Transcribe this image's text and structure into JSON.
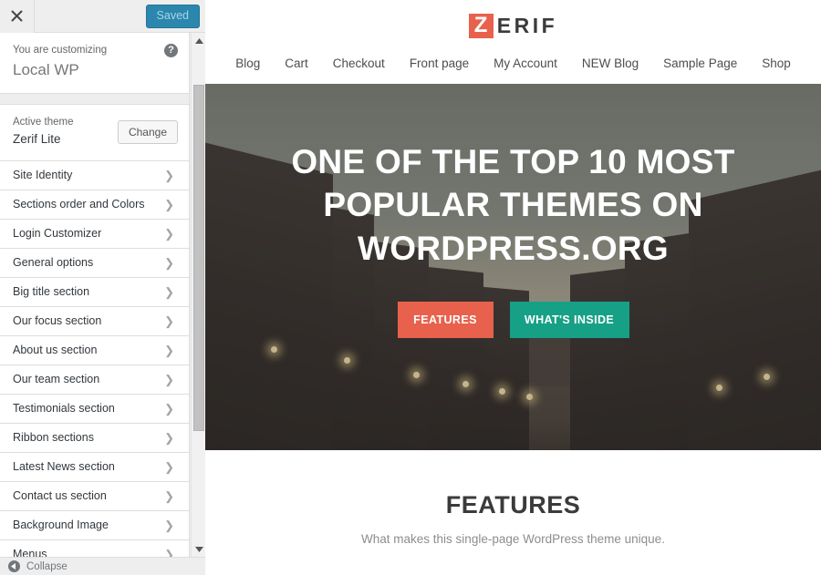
{
  "customizer": {
    "close_icon": "close-icon",
    "save_button": "Saved",
    "help_icon": "help-icon",
    "info_label": "You are customizing",
    "info_title": "Local WP",
    "theme_label": "Active theme",
    "theme_name": "Zerif Lite",
    "change_button": "Change",
    "collapse_label": "Collapse",
    "collapse_icon": "collapse-left-arrow-icon",
    "scroll_up_icon": "scroll-up-arrow-icon",
    "scroll_down_icon": "scroll-down-arrow-icon",
    "accent_color": "#2b87ad",
    "sections": [
      {
        "label": "Site Identity"
      },
      {
        "label": "Sections order and Colors"
      },
      {
        "label": "Login Customizer"
      },
      {
        "label": "General options"
      },
      {
        "label": "Big title section"
      },
      {
        "label": "Our focus section"
      },
      {
        "label": "About us section"
      },
      {
        "label": "Our team section"
      },
      {
        "label": "Testimonials section"
      },
      {
        "label": "Ribbon sections"
      },
      {
        "label": "Latest News section"
      },
      {
        "label": "Contact us section"
      },
      {
        "label": "Background Image"
      },
      {
        "label": "Menus"
      }
    ]
  },
  "preview": {
    "logo": {
      "mark": "Z",
      "rest": "ERIF",
      "mark_color": "#e8614c",
      "text_color": "#3b3b3b"
    },
    "nav": [
      {
        "label": "Blog"
      },
      {
        "label": "Cart"
      },
      {
        "label": "Checkout"
      },
      {
        "label": "Front page"
      },
      {
        "label": "My Account"
      },
      {
        "label": "NEW Blog"
      },
      {
        "label": "Sample Page"
      },
      {
        "label": "Shop"
      }
    ],
    "hero": {
      "title": "ONE OF THE TOP 10 MOST POPULAR THEMES ON WORDPRESS.ORG",
      "primary_button": "FEATURES",
      "secondary_button": "WHAT'S INSIDE",
      "primary_color": "#e8614c",
      "secondary_color": "#16a085"
    },
    "features": {
      "title": "FEATURES",
      "subtitle": "What makes this single-page WordPress theme unique."
    }
  }
}
